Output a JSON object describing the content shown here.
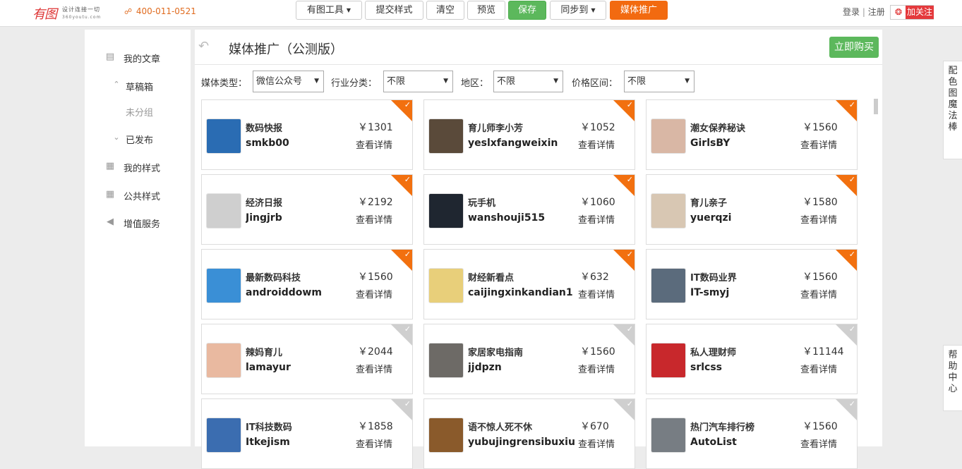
{
  "header": {
    "logo_main": "有图",
    "logo_tagline": "设计连接一切",
    "logo_url": "360youtu.com",
    "phone": "400-011-0521",
    "phone_icon": "headphone-icon",
    "buttons": {
      "tools": "有图工具",
      "submit_style": "提交样式",
      "clear": "清空",
      "preview": "预览",
      "save": "保存",
      "sync": "同步到",
      "media": "媒体推广"
    },
    "login": "登录",
    "sep": "|",
    "register": "注册",
    "follow": "加关注",
    "weibo_icon": "weibo-icon"
  },
  "sidebar": {
    "items": [
      {
        "label": "我的文章",
        "icon": "document-icon"
      },
      {
        "label": "草稿箱",
        "icon": "chevron-up-icon"
      },
      {
        "label": "未分组"
      },
      {
        "label": "已发布",
        "icon": "chevron-down-icon"
      },
      {
        "label": "我的样式",
        "icon": "style-doc-icon"
      },
      {
        "label": "公共样式",
        "icon": "public-style-icon"
      },
      {
        "label": "增值服务",
        "icon": "megaphone-icon"
      }
    ]
  },
  "main": {
    "title": "媒体推广（公测版）",
    "buy_now": "立即购买",
    "filters": [
      {
        "label": "媒体类型：",
        "value": "微信公众号"
      },
      {
        "label": "行业分类：",
        "value": "不限"
      },
      {
        "label": "地区：",
        "value": "不限"
      },
      {
        "label": "价格区间：",
        "value": "不限"
      }
    ],
    "detail_label": "查看详情",
    "cards": [
      {
        "name": "数码快报",
        "account": "smkb00",
        "price": "￥1301",
        "selected": true,
        "thumb": "#2a6cb3"
      },
      {
        "name": "育儿师李小芳",
        "account": "yeslxfangweixin",
        "price": "￥1052",
        "selected": true,
        "thumb": "#5a4a3a"
      },
      {
        "name": "潮女保养秘诀",
        "account": "GirlsBY",
        "price": "￥1560",
        "selected": true,
        "thumb": "#d9b7a5"
      },
      {
        "name": "经济日报",
        "account": "Jingjrb",
        "price": "￥2192",
        "selected": true,
        "thumb": "#cfcfcf"
      },
      {
        "name": "玩手机",
        "account": "wanshouji515",
        "price": "￥1060",
        "selected": true,
        "thumb": "#1f2630"
      },
      {
        "name": "育儿亲子",
        "account": "yuerqzi",
        "price": "￥1580",
        "selected": true,
        "thumb": "#d8c7b3"
      },
      {
        "name": "最新数码科技",
        "account": "androiddowm",
        "price": "￥1560",
        "selected": true,
        "thumb": "#3a8fd6"
      },
      {
        "name": "财经新看点",
        "account": "caijingxinkandian1",
        "price": "￥632",
        "selected": true,
        "thumb": "#e8cf7a"
      },
      {
        "name": "IT数码业界",
        "account": "IT-smyj",
        "price": "￥1560",
        "selected": true,
        "thumb": "#5b6b7c"
      },
      {
        "name": "辣妈育儿",
        "account": "lamayur",
        "price": "￥2044",
        "selected": false,
        "thumb": "#e9b9a0"
      },
      {
        "name": "家居家电指南",
        "account": "jjdpzn",
        "price": "￥1560",
        "selected": false,
        "thumb": "#6d6a66"
      },
      {
        "name": "私人理财师",
        "account": "srlcss",
        "price": "￥11144",
        "selected": false,
        "thumb": "#c8282c"
      },
      {
        "name": "IT科技数码",
        "account": "Itkejism",
        "price": "￥1858",
        "selected": false,
        "thumb": "#3b6db0"
      },
      {
        "name": "语不惊人死不休",
        "account": "yubujingrensibuxiu",
        "price": "￥670",
        "selected": false,
        "thumb": "#8a5a2b"
      },
      {
        "name": "热门汽车排行榜",
        "account": "AutoList",
        "price": "￥1560",
        "selected": false,
        "thumb": "#777d83"
      }
    ]
  },
  "right_tabs": {
    "palette": "配色图魔法棒",
    "help": "帮助中心"
  },
  "colors": {
    "accent_orange": "#f26a10",
    "accent_green": "#5cb85c",
    "weibo_red": "#e4393c"
  }
}
